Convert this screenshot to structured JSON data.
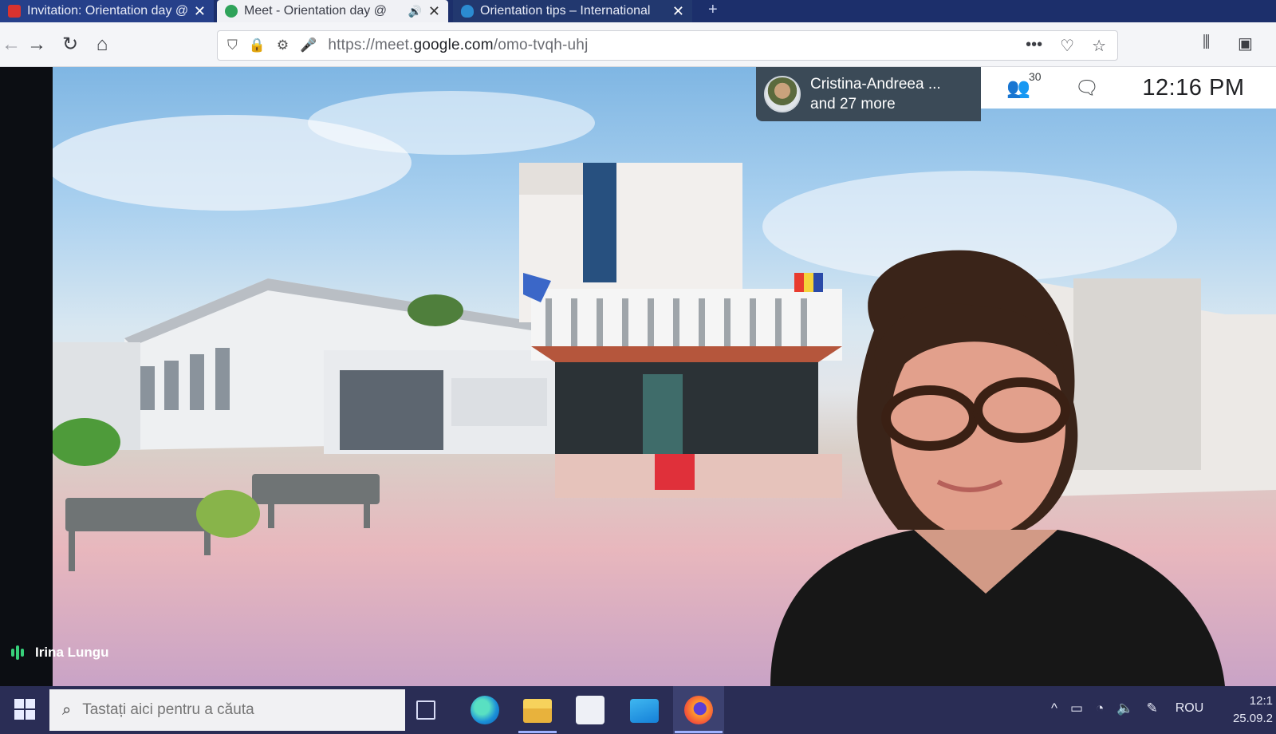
{
  "browser": {
    "tabs": [
      {
        "title": "Invitation: Orientation day @ T",
        "close": "✕"
      },
      {
        "title": "Meet - Orientation day @ ",
        "close": "✕",
        "audio": "🔊"
      },
      {
        "title": "Orientation tips – International",
        "close": "✕"
      }
    ],
    "new_tab": "+",
    "url_prefix": "https://meet.",
    "url_domain": "google.com",
    "url_path": "/omo-tvqh-uhj",
    "page_actions": "•••"
  },
  "meet": {
    "participants_label_line1": "Cristina-Andreea ...",
    "participants_label_line2": "and 27 more",
    "participant_count": "30",
    "clock": "12:16 PM",
    "speaker_name": "Irina Lungu",
    "accent_color": "#37d07a"
  },
  "taskbar": {
    "search_placeholder": "Tastați aici pentru a căuta",
    "language": "ROU",
    "time": "12:1",
    "date": "25.09.2"
  }
}
